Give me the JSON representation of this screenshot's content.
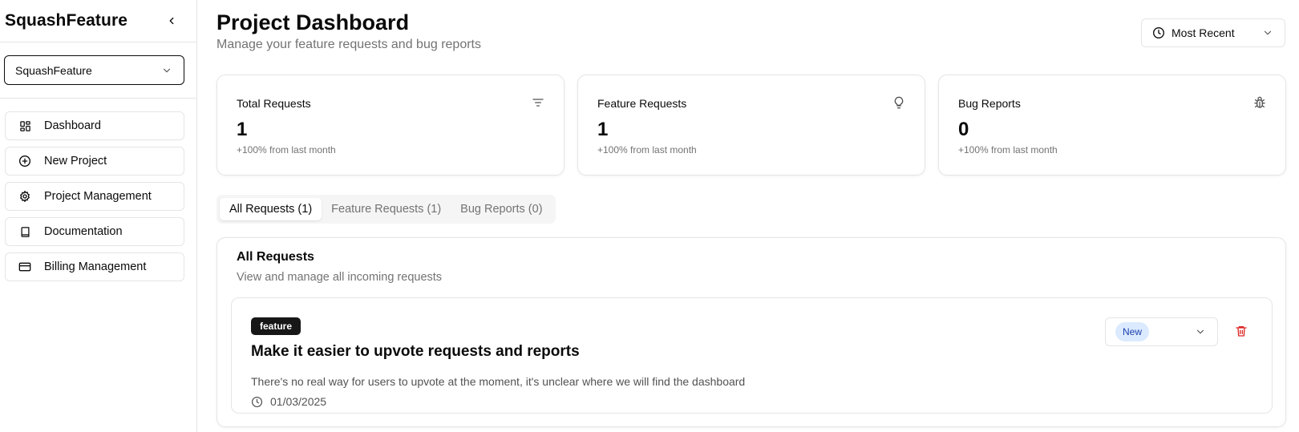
{
  "sidebar": {
    "brand": "SquashFeature",
    "project_select": "SquashFeature",
    "nav": [
      {
        "label": "Dashboard",
        "icon": "layout-dashboard-icon"
      },
      {
        "label": "New Project",
        "icon": "plus-circle-icon"
      },
      {
        "label": "Project Management",
        "icon": "gear-icon"
      },
      {
        "label": "Documentation",
        "icon": "book-icon"
      },
      {
        "label": "Billing Management",
        "icon": "credit-card-icon"
      }
    ]
  },
  "header": {
    "title": "Project Dashboard",
    "subtitle": "Manage your feature requests and bug reports",
    "sort_value": "Most Recent"
  },
  "stats": [
    {
      "title": "Total Requests",
      "value": "1",
      "change": "+100% from last month",
      "icon": "filter-icon"
    },
    {
      "title": "Feature Requests",
      "value": "1",
      "change": "+100% from last month",
      "icon": "lightbulb-icon"
    },
    {
      "title": "Bug Reports",
      "value": "0",
      "change": "+100% from last month",
      "icon": "bug-icon"
    }
  ],
  "tabs": [
    {
      "label": "All Requests (1)",
      "active": true
    },
    {
      "label": "Feature Requests (1)",
      "active": false
    },
    {
      "label": "Bug Reports (0)",
      "active": false
    }
  ],
  "panel": {
    "title": "All Requests",
    "description": "View and manage all incoming requests"
  },
  "requests": [
    {
      "type": "feature",
      "title": "Make it easier to upvote requests and reports",
      "description": "There's no real way for users to upvote at the moment, it's unclear where we will find the dashboard",
      "date": "01/03/2025",
      "status": "New"
    }
  ],
  "colors": {
    "delete": "#dc2626",
    "status_bg": "#dbeafe",
    "status_text": "#1e40af",
    "badge_bg": "#171717"
  }
}
